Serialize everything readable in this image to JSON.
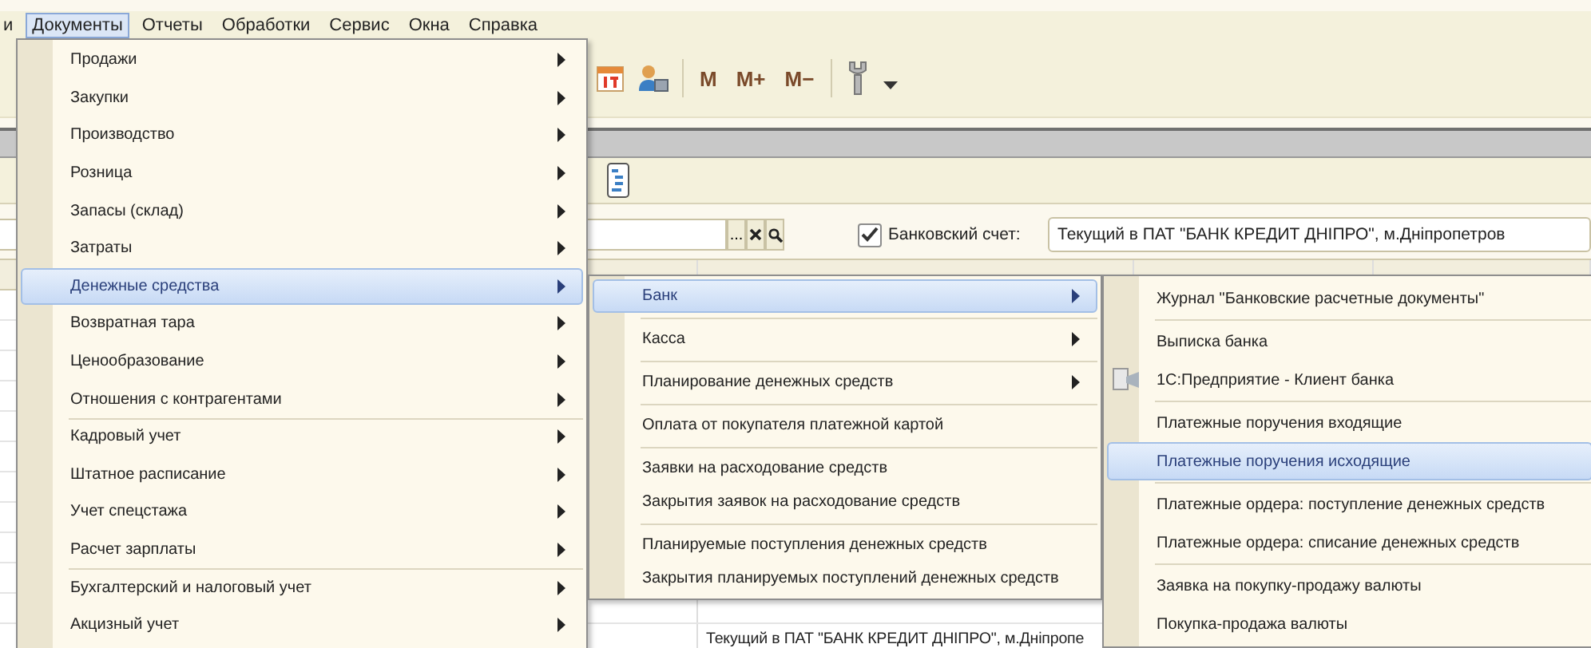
{
  "menubar": [
    {
      "label": "и",
      "selected": false
    },
    {
      "label": "Документы",
      "selected": true
    },
    {
      "label": "Отчеты",
      "selected": false
    },
    {
      "label": "Обработки",
      "selected": false
    },
    {
      "label": "Сервис",
      "selected": false
    },
    {
      "label": "Окна",
      "selected": false
    },
    {
      "label": "Справка",
      "selected": false
    }
  ],
  "toolbar": {
    "memory_buttons": [
      "M",
      "M+",
      "M−"
    ]
  },
  "filter": {
    "picker_button": "...",
    "bank_account": {
      "label": "Банковский счет:",
      "checked": true,
      "value": "Текущий в ПАТ \"БАНК КРЕДИТ ДНІПРО\", м.Дніпропетров"
    }
  },
  "table": {
    "rows": [
      {
        "account": "Текущий в ПАТ \"БАНК КРЕДИТ ДНІПРО\", м.Дніпропе"
      }
    ]
  },
  "menus": [
    {
      "items": [
        {
          "kind": "item",
          "label": "Продажи",
          "submenu": true,
          "selected": false
        },
        {
          "kind": "item",
          "label": "Закупки",
          "submenu": true,
          "selected": false
        },
        {
          "kind": "item",
          "label": "Производство",
          "submenu": true,
          "selected": false
        },
        {
          "kind": "item",
          "label": "Розница",
          "submenu": true,
          "selected": false
        },
        {
          "kind": "item",
          "label": "Запасы (склад)",
          "submenu": true,
          "selected": false
        },
        {
          "kind": "item",
          "label": "Затраты",
          "submenu": true,
          "selected": false
        },
        {
          "kind": "item",
          "label": "Денежные средства",
          "submenu": true,
          "selected": true
        },
        {
          "kind": "item",
          "label": "Возвратная тара",
          "submenu": true,
          "selected": false
        },
        {
          "kind": "item",
          "label": "Ценообразование",
          "submenu": true,
          "selected": false
        },
        {
          "kind": "item",
          "label": "Отношения с контрагентами",
          "submenu": true,
          "selected": false
        },
        {
          "kind": "separator"
        },
        {
          "kind": "item",
          "label": "Кадровый учет",
          "submenu": true,
          "selected": false
        },
        {
          "kind": "item",
          "label": "Штатное расписание",
          "submenu": true,
          "selected": false
        },
        {
          "kind": "item",
          "label": "Учет спецстажа",
          "submenu": true,
          "selected": false
        },
        {
          "kind": "item",
          "label": "Расчет зарплаты",
          "submenu": true,
          "selected": false
        },
        {
          "kind": "separator"
        },
        {
          "kind": "item",
          "label": "Бухгалтерский и налоговый учет",
          "submenu": true,
          "selected": false
        },
        {
          "kind": "item",
          "label": "Акцизный учет",
          "submenu": true,
          "selected": false
        }
      ]
    },
    {
      "items": [
        {
          "kind": "item",
          "label": "Банк",
          "submenu": true,
          "selected": true
        },
        {
          "kind": "separator"
        },
        {
          "kind": "item",
          "label": "Касса",
          "submenu": true,
          "selected": false
        },
        {
          "kind": "separator"
        },
        {
          "kind": "item",
          "label": "Планирование денежных средств",
          "submenu": true,
          "selected": false
        },
        {
          "kind": "separator"
        },
        {
          "kind": "item",
          "label": "Оплата от покупателя платежной картой",
          "submenu": false,
          "selected": false
        },
        {
          "kind": "separator"
        },
        {
          "kind": "item",
          "label": "Заявки на расходование средств",
          "submenu": false,
          "selected": false
        },
        {
          "kind": "item",
          "label": "Закрытия заявок на расходование средств",
          "submenu": false,
          "selected": false
        },
        {
          "kind": "separator"
        },
        {
          "kind": "item",
          "label": "Планируемые поступления денежных средств",
          "submenu": false,
          "selected": false
        },
        {
          "kind": "item",
          "label": "Закрытия планируемых поступлений денежных средств",
          "submenu": false,
          "selected": false
        }
      ]
    },
    {
      "items": [
        {
          "kind": "item",
          "label": "Журнал \"Банковские расчетные документы\"",
          "submenu": false,
          "selected": false
        },
        {
          "kind": "separator"
        },
        {
          "kind": "item",
          "label": "Выписка банка",
          "submenu": false,
          "selected": false
        },
        {
          "kind": "item",
          "label": "1С:Предприятие - Клиент банка",
          "submenu": false,
          "selected": false,
          "icon": true
        },
        {
          "kind": "separator"
        },
        {
          "kind": "item",
          "label": "Платежные поручения входящие",
          "submenu": false,
          "selected": false
        },
        {
          "kind": "item",
          "label": "Платежные поручения исходящие",
          "submenu": false,
          "selected": true
        },
        {
          "kind": "separator"
        },
        {
          "kind": "item",
          "label": "Платежные ордера: поступление денежных средств",
          "submenu": false,
          "selected": false
        },
        {
          "kind": "item",
          "label": "Платежные ордера: списание денежных средств",
          "submenu": false,
          "selected": false
        },
        {
          "kind": "separator"
        },
        {
          "kind": "item",
          "label": "Заявка на покупку-продажу валюты",
          "submenu": false,
          "selected": false
        },
        {
          "kind": "item",
          "label": "Покупка-продажа валюты",
          "submenu": false,
          "selected": false
        }
      ]
    }
  ]
}
